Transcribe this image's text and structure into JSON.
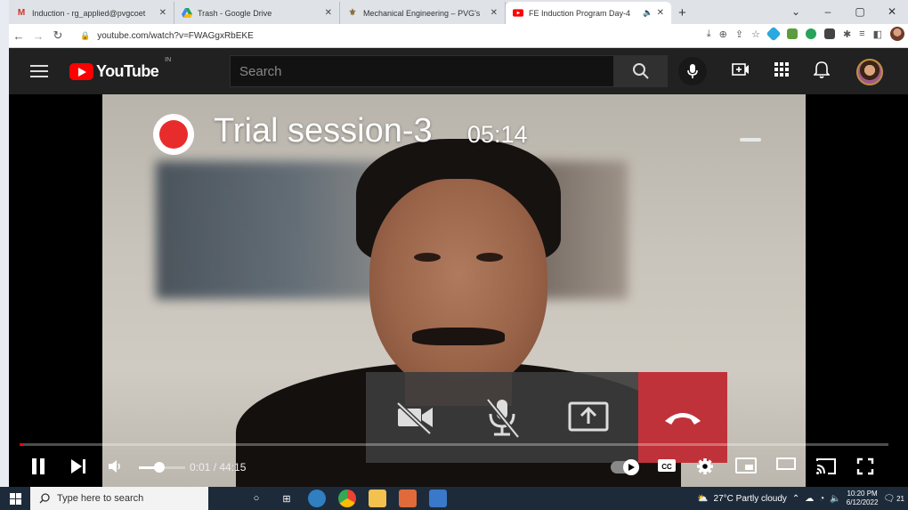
{
  "browser": {
    "tabs": [
      {
        "title": "Induction - rg_applied@pvgcoet",
        "favicon": "gmail-icon",
        "color": "#d93025"
      },
      {
        "title": "Trash - Google Drive",
        "favicon": "drive-icon",
        "color": "#1fa463"
      },
      {
        "title": "Mechanical Engineering – PVG's",
        "favicon": "site-icon",
        "color": "#8a6d3b"
      },
      {
        "title": "FE Induction Program Day-4",
        "favicon": "youtube-icon",
        "color": "#ff0000"
      }
    ],
    "new_tab_label": "+",
    "url": "youtube.com/watch?v=FWAGgxRbEKE",
    "window_controls": [
      "⌄",
      "–",
      "▢",
      "✕"
    ]
  },
  "youtube": {
    "logo_text": "YouTube",
    "country_code": "IN",
    "search_placeholder": "Search"
  },
  "video": {
    "overlay_title": "Trial session-3",
    "overlay_time": "05:14",
    "progress_fraction": 0.0004,
    "volume_fraction": 0.45,
    "time_display": "0:01 / 44:15",
    "autoplay_on": true
  },
  "taskbar": {
    "search_placeholder": "Type here to search",
    "weather": "27°C  Partly cloudy",
    "time": "10:20 PM",
    "date": "6/12/2022",
    "notification_count": "21"
  },
  "colors": {
    "youtube_red": "#ff0000",
    "end_call_red": "#c0323a",
    "header_bg": "#212121"
  }
}
